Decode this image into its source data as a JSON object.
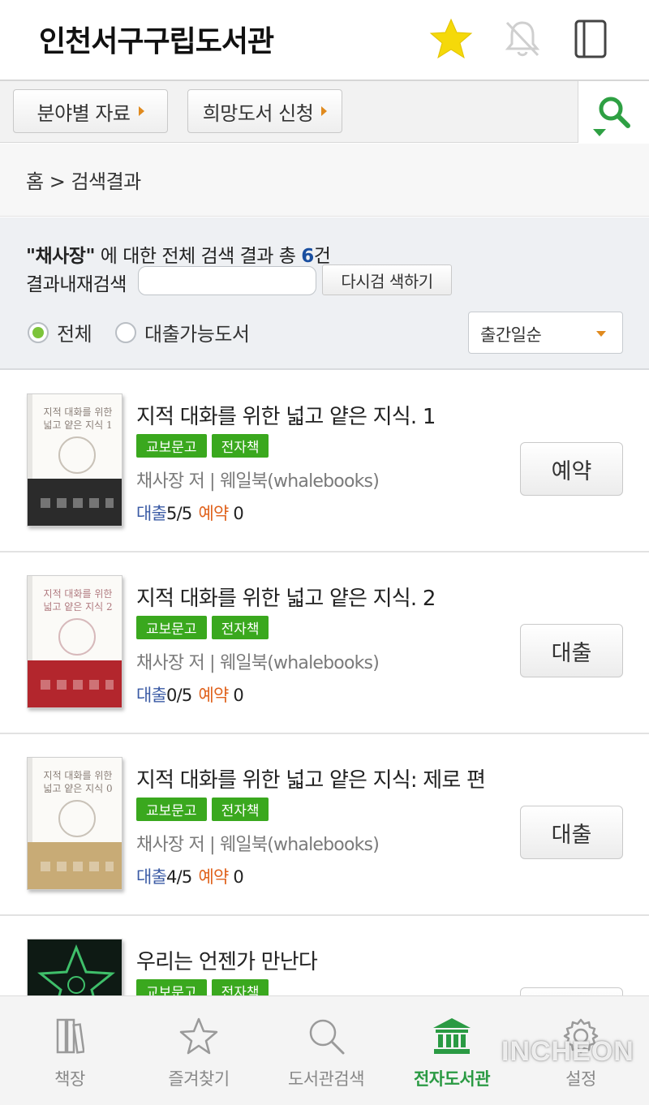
{
  "header": {
    "title": "인천서구구립도서관",
    "icons": [
      "star-icon",
      "bell-off-icon",
      "book-icon"
    ]
  },
  "toolbar": {
    "category_label": "분야별 자료",
    "request_label": "희망도서 신청"
  },
  "breadcrumb": "홈 > 검색결과",
  "search": {
    "query": "\"채사장\"",
    "result_text": " 에 대한 전체 검색 결과 총 ",
    "count": "6",
    "count_suffix": "건",
    "refine_label": "결과내재검색",
    "refine_value": "",
    "refine_button": "다시검 색하기",
    "filter_all": "전체",
    "filter_available": "대출가능도서",
    "filter_selected": "전체",
    "sort_value": "출간일순"
  },
  "books": [
    {
      "title": "지적 대화를 위한 넓고 얕은 지식. 1",
      "badge1": "교보문고",
      "badge2": "전자책",
      "author": "채사장 저 | 웨일북(whalebooks)",
      "loan_label": "대출",
      "loan_value": "5/5",
      "reserve_label": "예약",
      "reserve_value": "0",
      "action": "예약",
      "cover_title": "지적 대화를 위한 넓고 얕은 지식 1"
    },
    {
      "title": "지적 대화를 위한 넓고 얕은 지식. 2",
      "badge1": "교보문고",
      "badge2": "전자책",
      "author": "채사장 저 | 웨일북(whalebooks)",
      "loan_label": "대출",
      "loan_value": "0/5",
      "reserve_label": "예약",
      "reserve_value": "0",
      "action": "대출",
      "cover_title": "지적 대화를 위한 넓고 얕은 지식 2"
    },
    {
      "title": "지적 대화를 위한 넓고 얕은 지식: 제로 편",
      "badge1": "교보문고",
      "badge2": "전자책",
      "author": "채사장 저 | 웨일북(whalebooks)",
      "loan_label": "대출",
      "loan_value": "4/5",
      "reserve_label": "예약",
      "reserve_value": "0",
      "action": "대출",
      "cover_title": "지적 대화를 위한 넓고 얕은 지식 0"
    },
    {
      "title": "우리는 언젠가 만난다",
      "badge1": "교보문고",
      "badge2": "전자책"
    }
  ],
  "bottom_nav": [
    {
      "label": "책장",
      "icon": "bookshelf-icon"
    },
    {
      "label": "즐겨찾기",
      "icon": "star-outline-icon"
    },
    {
      "label": "도서관검색",
      "icon": "search-icon"
    },
    {
      "label": "전자도서관",
      "icon": "library-icon",
      "active": true
    },
    {
      "label": "설정",
      "icon": "gear-icon"
    }
  ],
  "watermark": "INCHEON",
  "colors": {
    "accent_green": "#3aa81e",
    "active_green": "#2a9a43",
    "loan_blue": "#3b5ba5",
    "reserve_orange": "#e0631e",
    "star_yellow": "#f5d90a",
    "count_blue": "#1a4fa0"
  }
}
